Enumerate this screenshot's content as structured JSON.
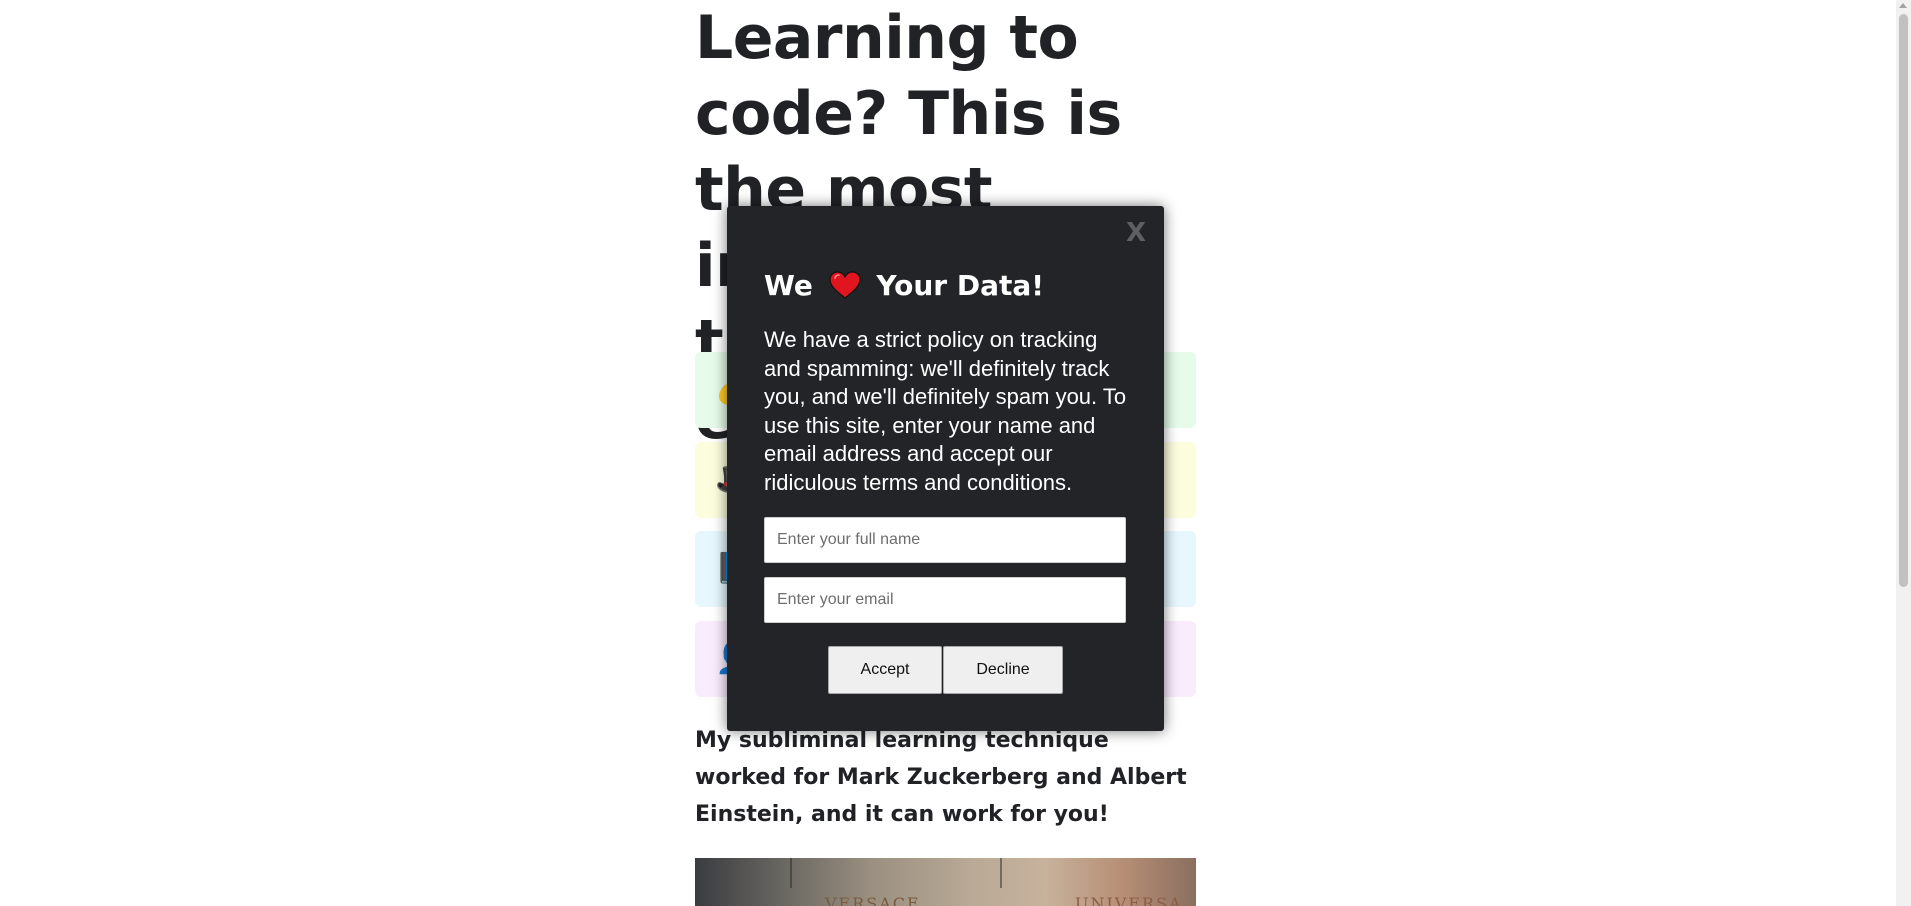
{
  "article": {
    "headline": "Learning to code? This is the most important thing you'll ever read!",
    "tagline": "My subliminal learning technique worked for Mark Zuckerberg and Albert Einstein, and it can work for you!",
    "cards": [
      {
        "icon": "money-bag-icon",
        "glyph": "💰",
        "color": "#e6fbea"
      },
      {
        "icon": "hat-icon",
        "glyph": "🎩",
        "color": "#fcfddd"
      },
      {
        "icon": "book-icon",
        "glyph": "📘",
        "color": "#e6f7fd"
      },
      {
        "icon": "person-icon",
        "glyph": "👤",
        "color": "#f9ecfd"
      }
    ],
    "hero_signs": [
      "VERSACE",
      "UNIVERSA"
    ]
  },
  "modal": {
    "close_label": "X",
    "title_before": "We",
    "title_after": "Your Data!",
    "body": "We have a strict policy on tracking and spamming: we'll definitely track you, and we'll definitely spam you. To use this site, enter your name and email address and accept our ridiculous terms and conditions.",
    "name_placeholder": "Enter your full name",
    "email_placeholder": "Enter your email",
    "accept_label": "Accept",
    "decline_label": "Decline",
    "heart_color": "#e0151f"
  }
}
